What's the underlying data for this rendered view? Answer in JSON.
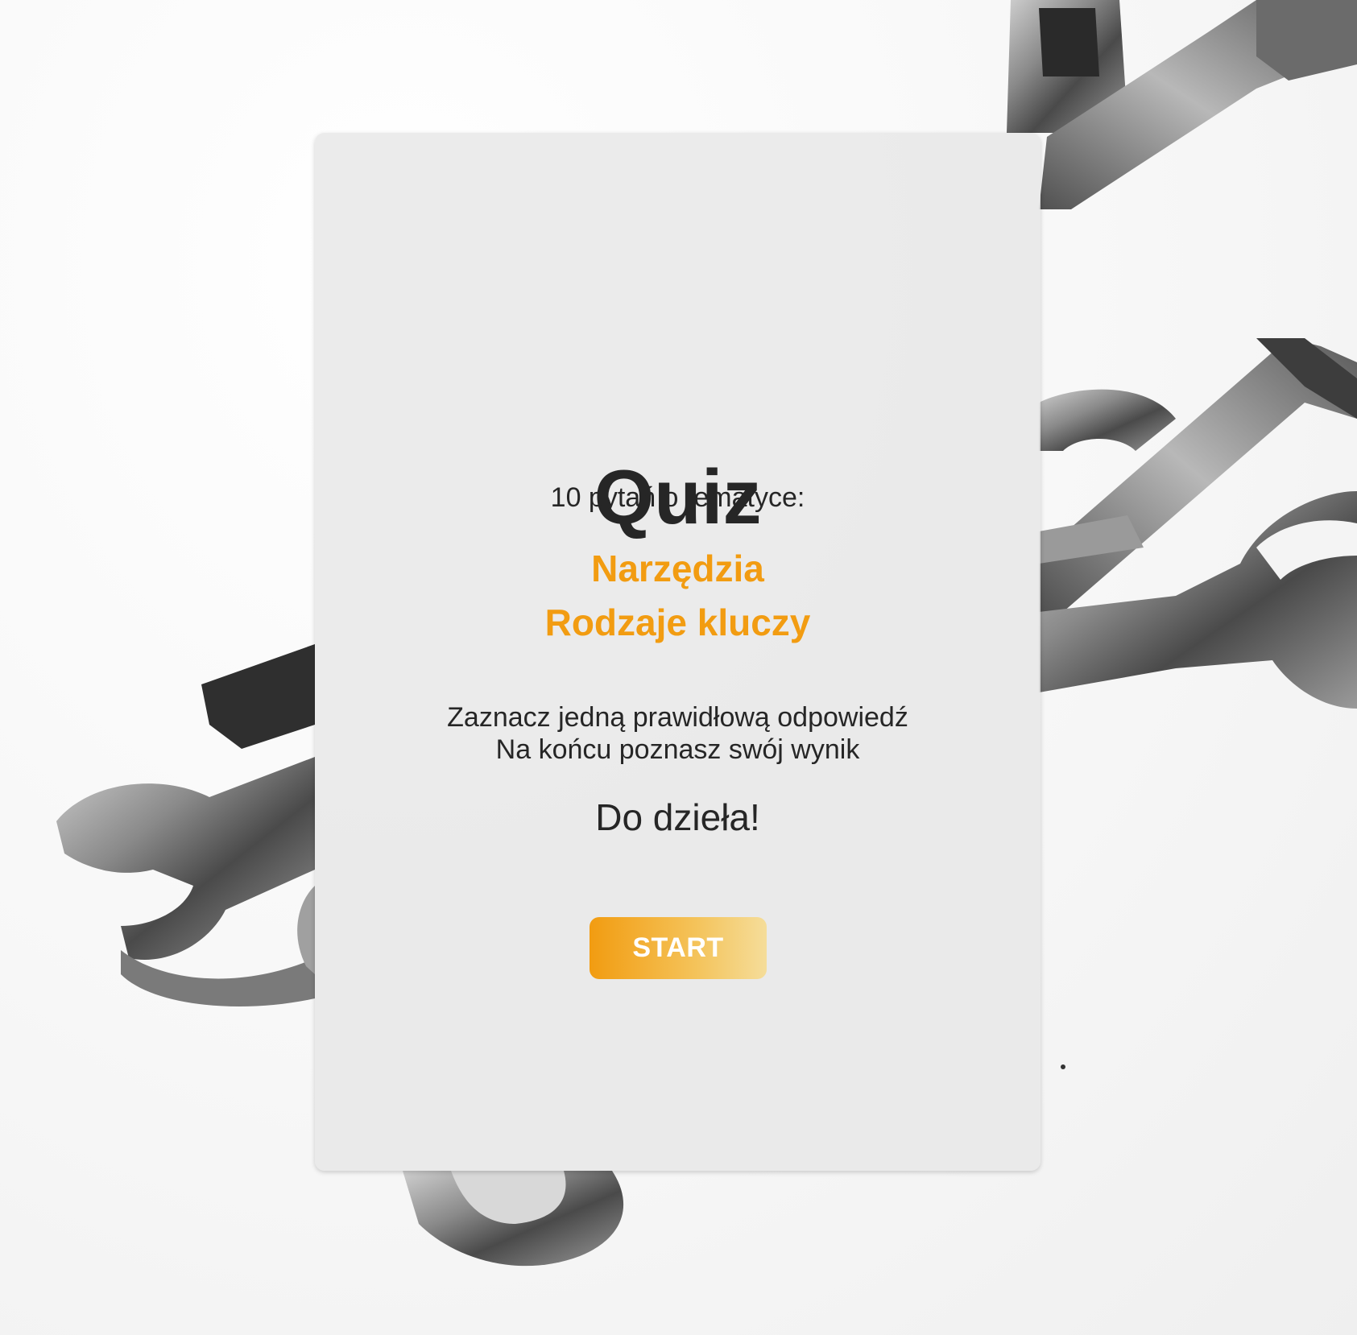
{
  "quiz": {
    "title": "Quiz",
    "intro": "10 pytań o tematyce:",
    "topics": [
      "Narzędzia",
      "Rodzaje kluczy"
    ],
    "instructions": [
      "Zaznacz jedną prawidłową odpowiedź",
      "Na końcu poznasz swój wynik"
    ],
    "cta_text": "Do dzieła!",
    "start_label": "START"
  },
  "colors": {
    "accent": "#f29c11",
    "text": "#262626",
    "card": "#e8e8e8"
  },
  "background": {
    "image": "wrenches-photo"
  }
}
